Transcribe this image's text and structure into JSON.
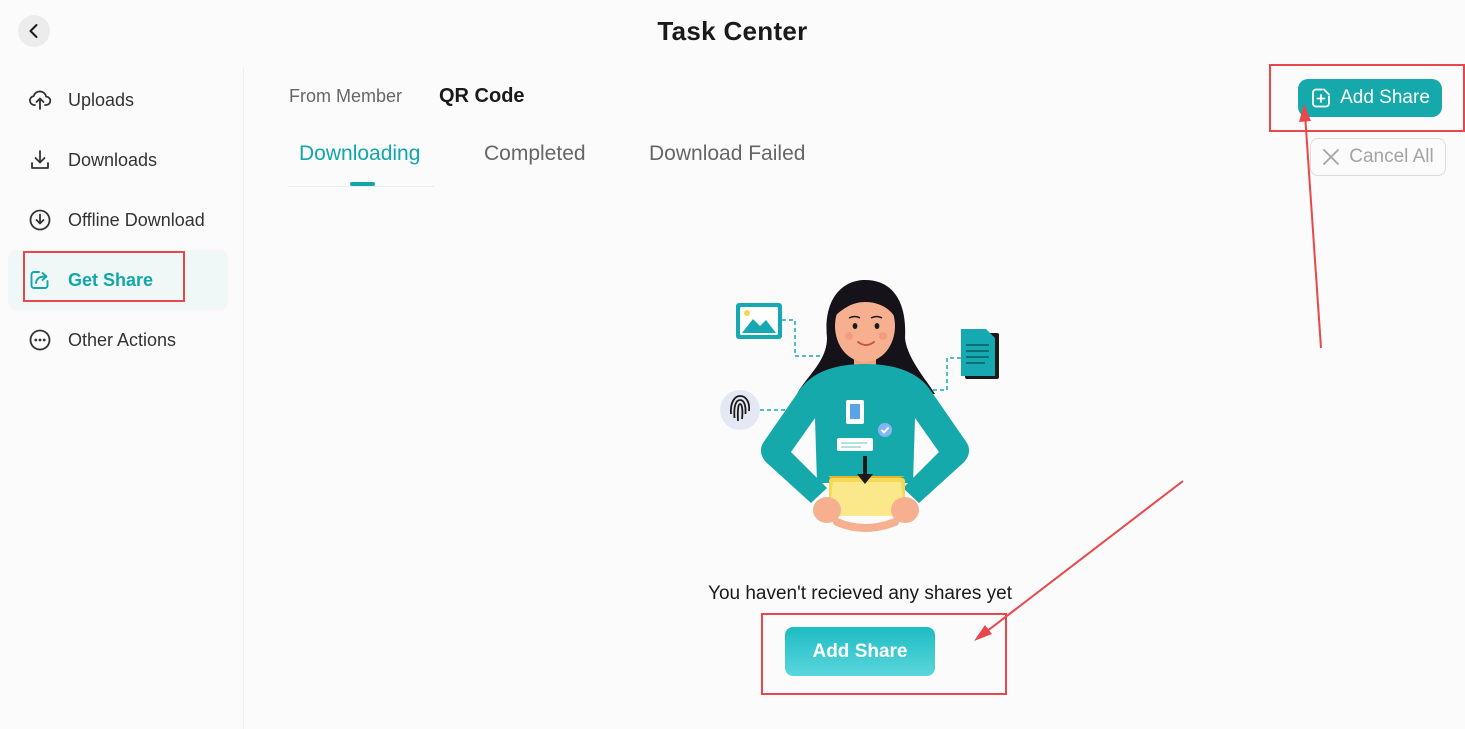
{
  "header": {
    "title": "Task Center"
  },
  "sidebar": {
    "items": [
      {
        "label": "Uploads",
        "icon": "upload-cloud-icon"
      },
      {
        "label": "Downloads",
        "icon": "download-icon"
      },
      {
        "label": "Offline Download",
        "icon": "download-circle-icon"
      },
      {
        "label": "Get Share",
        "icon": "share-icon",
        "active": true
      },
      {
        "label": "Other Actions",
        "icon": "more-circle-icon"
      }
    ]
  },
  "source_switch": {
    "from_member": "From Member",
    "qr_code": "QR Code"
  },
  "tabs": [
    {
      "label": "Downloading",
      "active": true
    },
    {
      "label": "Completed"
    },
    {
      "label": "Download Failed"
    }
  ],
  "toolbar": {
    "add_share_label": "Add Share",
    "cancel_all_label": "Cancel All"
  },
  "empty_state": {
    "message": "You haven't recieved any shares yet",
    "button_label": "Add Share"
  },
  "colors": {
    "accent": "#12a6ac",
    "annotation": "#e8474b",
    "active_bg": "#f0f8f7"
  }
}
